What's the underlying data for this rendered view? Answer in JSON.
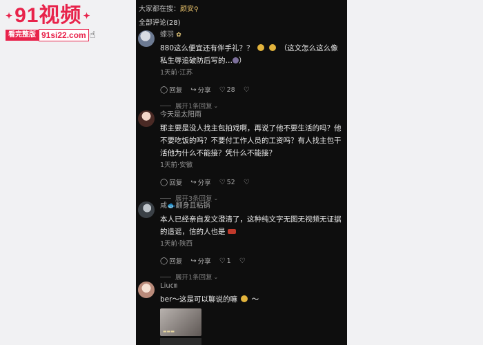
{
  "watermark": {
    "title": "91视频",
    "badge": "看完整版",
    "url": "91si22.com"
  },
  "search": {
    "prefix": "大家都在搜：",
    "term": "颜安"
  },
  "comment_count": "全部评论(28)",
  "comments": [
    {
      "username": "蝶羽",
      "text_a": "880这么便宜还有伴手礼？？",
      "text_b": "（这文怎么这么像私生",
      "text_c": "辱追破防后写的…",
      "text_d": "）",
      "meta": "1天前·江苏",
      "reply": "回复",
      "share": "分享",
      "likes": "28",
      "expand": "展开1条回复"
    },
    {
      "username": "今天是太阳雨",
      "text": "那主要是没人找主包拍戏啊，再说了他不要生活的吗？他不要吃饭的吗？不要付工作人员的工资吗？有人找主包干活他为什么不能接？凭什么不能接？",
      "meta": "1天前·安徽",
      "reply": "回复",
      "share": "分享",
      "likes": "52",
      "expand": "展开3条回复"
    },
    {
      "username": "咸🐟翻身且粘锅",
      "text": "本人已经亲自发文澄清了，这种纯文字无图无视频无证据的造谣，信的人也是",
      "meta": "1天前·陕西",
      "reply": "回复",
      "share": "分享",
      "likes": "1",
      "expand": "展开1条回复"
    },
    {
      "username": "Liu㎝",
      "text_a": "ber～这是可以聊说的嘛",
      "text_b": "～"
    }
  ]
}
